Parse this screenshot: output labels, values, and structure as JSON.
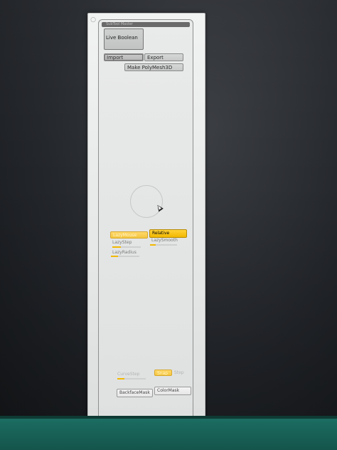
{
  "palette": {
    "title": "SubTool Master",
    "corner_icon": "circle-icon",
    "live_boolean_label": "Live Boolean",
    "import_label": "Import",
    "export_label": "Export",
    "make_polymesh_label": "Make PolyMesh3D"
  },
  "lazy": {
    "lazy_mouse_label": "LazyMouse",
    "relative_label": "Relative",
    "lazy_step_label": "LazyStep",
    "lazy_smooth_label": "LazySmooth",
    "lazy_radius_label": "LazyRadius",
    "lazy_step_level": 0.3,
    "lazy_smooth_level": 0.2,
    "lazy_radius_level": 0.25
  },
  "curve": {
    "curve_step_label": "CurveStep",
    "snap_label": "Snap",
    "step_label": "Step",
    "curve_step_level": 0.25
  },
  "masks": {
    "backface_mask_label": "BackfaceMask",
    "color_mask_label": "ColorMask"
  },
  "colors": {
    "accent_yellow": "#f2b800",
    "taskbar_teal": "#1c6d62"
  }
}
